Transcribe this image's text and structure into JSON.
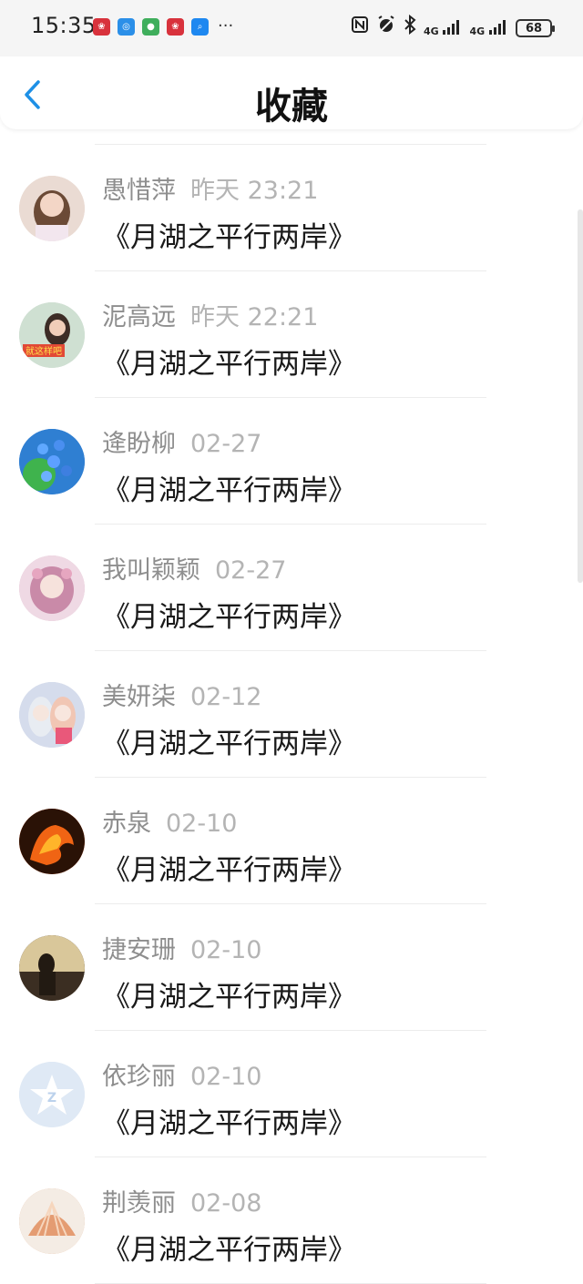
{
  "status_bar": {
    "time": "15:35",
    "notifications": [
      "huawei-icon",
      "qq-browser-icon",
      "panda-icon",
      "huawei-icon",
      "search-icon"
    ],
    "more": "···",
    "network1": "4G",
    "network2": "4G",
    "battery": "68"
  },
  "nav": {
    "title": "收藏"
  },
  "favorites": [
    {
      "name": "愚惜萍",
      "time": "昨天 23:21",
      "title": "《月湖之平行两岸》",
      "avatar": "girl-photo-avatar",
      "avatar_color": "#e8d7cf"
    },
    {
      "name": "泥高远",
      "time": "昨天 22:21",
      "title": "《月湖之平行两岸》",
      "avatar": "girl-poster-avatar",
      "avatar_color": "#c8d8cc"
    },
    {
      "name": "逄盼柳",
      "time": "02-27",
      "title": "《月湖之平行两岸》",
      "avatar": "blue-flower-avatar",
      "avatar_color": "#3a7fd0"
    },
    {
      "name": "我叫颖颖",
      "time": "02-27",
      "title": "《月湖之平行两岸》",
      "avatar": "anime-girl-avatar",
      "avatar_color": "#e2c0cf"
    },
    {
      "name": "美妍柒",
      "time": "02-12",
      "title": "《月湖之平行两岸》",
      "avatar": "anime-pair-avatar",
      "avatar_color": "#cfd6e6"
    },
    {
      "name": "赤泉",
      "time": "02-10",
      "title": "《月湖之平行两岸》",
      "avatar": "fire-horse-avatar",
      "avatar_color": "#d24a12"
    },
    {
      "name": "捷安珊",
      "time": "02-10",
      "title": "《月湖之平行两岸》",
      "avatar": "sunset-silhouette-avatar",
      "avatar_color": "#5a4a36"
    },
    {
      "name": "依珍丽",
      "time": "02-10",
      "title": "《月湖之平行两岸》",
      "avatar": "default-qzone-avatar",
      "avatar_color": "#dde8f4"
    },
    {
      "name": "荆羡丽",
      "time": "02-08",
      "title": "《月湖之平行两岸》",
      "avatar": "seashell-avatar",
      "avatar_color": "#e6b99a"
    }
  ]
}
